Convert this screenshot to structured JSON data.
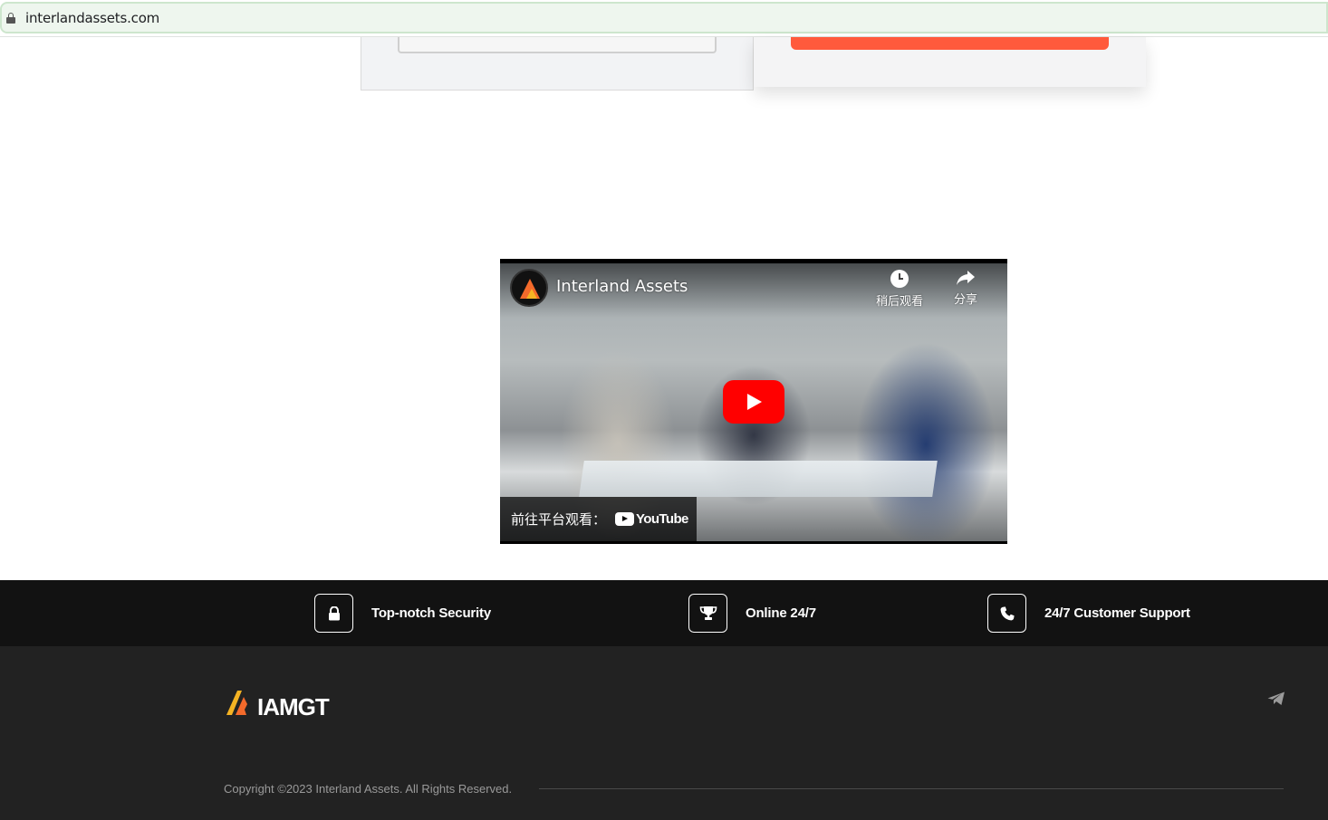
{
  "browser": {
    "url": "interlandassets.com"
  },
  "video": {
    "title": "Interland Assets",
    "watch_later_label": "稍后观看",
    "share_label": "分享",
    "watch_on_label": "前往平台观看：",
    "platform_label": "YouTube"
  },
  "features": [
    {
      "label": "Top-notch Security",
      "icon": "lock-icon"
    },
    {
      "label": "Online 24/7",
      "icon": "trophy-icon"
    },
    {
      "label": "24/7 Customer Support",
      "icon": "phone-icon"
    }
  ],
  "footer": {
    "logo_text": "IAMGT",
    "copyright": "Copyright ©2023 Interland Assets. All Rights Reserved.",
    "social_icon": "telegram-icon"
  },
  "colors": {
    "accent_orange": "#ff5a3c",
    "footer_bg": "#222222",
    "strip_bg": "#121212",
    "youtube_red": "#ff0000"
  }
}
